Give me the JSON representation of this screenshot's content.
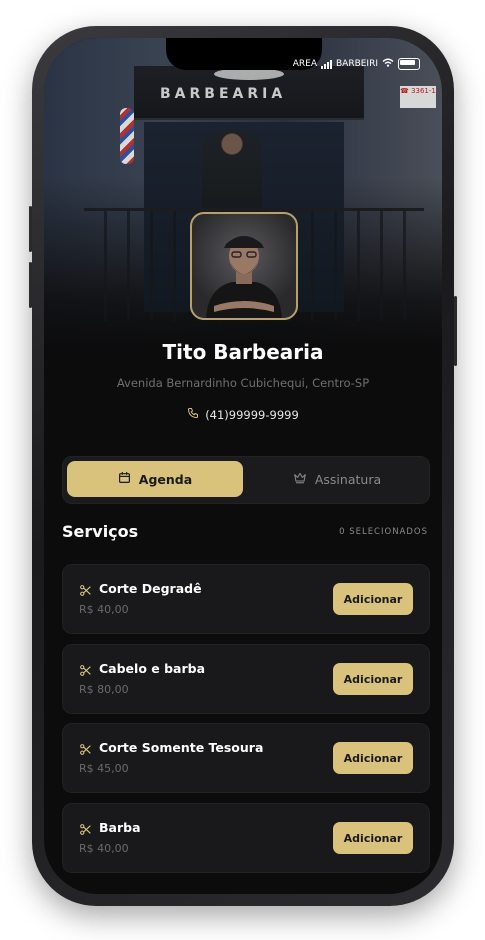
{
  "status_bar": {
    "carrier": "AREA",
    "carrier_right": "BARBEIRI"
  },
  "hero": {
    "sign_text": "BARBEARIA",
    "side_sign": "☎ 3361-1"
  },
  "shop": {
    "name": "Tito Barbearia",
    "address": "Avenida Bernardinho Cubichequi, Centro-SP",
    "phone": "(41)99999-9999"
  },
  "tabs": [
    {
      "label": "Agenda",
      "icon": "calendar-icon",
      "active": true
    },
    {
      "label": "Assinatura",
      "icon": "crown-icon",
      "active": false
    }
  ],
  "services_section": {
    "title": "Serviços",
    "selected_label": "0 SELECIONADOS"
  },
  "services": [
    {
      "name": "Corte Degradê",
      "price": "R$ 40,00",
      "button": "Adicionar",
      "icon": "scissors-icon"
    },
    {
      "name": "Cabelo e barba",
      "price": "R$ 80,00",
      "button": "Adicionar",
      "icon": "scissors-icon"
    },
    {
      "name": "Corte Somente Tesoura",
      "price": "R$ 45,00",
      "button": "Adicionar",
      "icon": "scissors-icon"
    },
    {
      "name": "Barba",
      "price": "R$ 40,00",
      "button": "Adicionar",
      "icon": "scissors-icon"
    }
  ],
  "colors": {
    "accent": "#d9c27c",
    "background": "#0c0c0d",
    "card": "#19191b"
  }
}
